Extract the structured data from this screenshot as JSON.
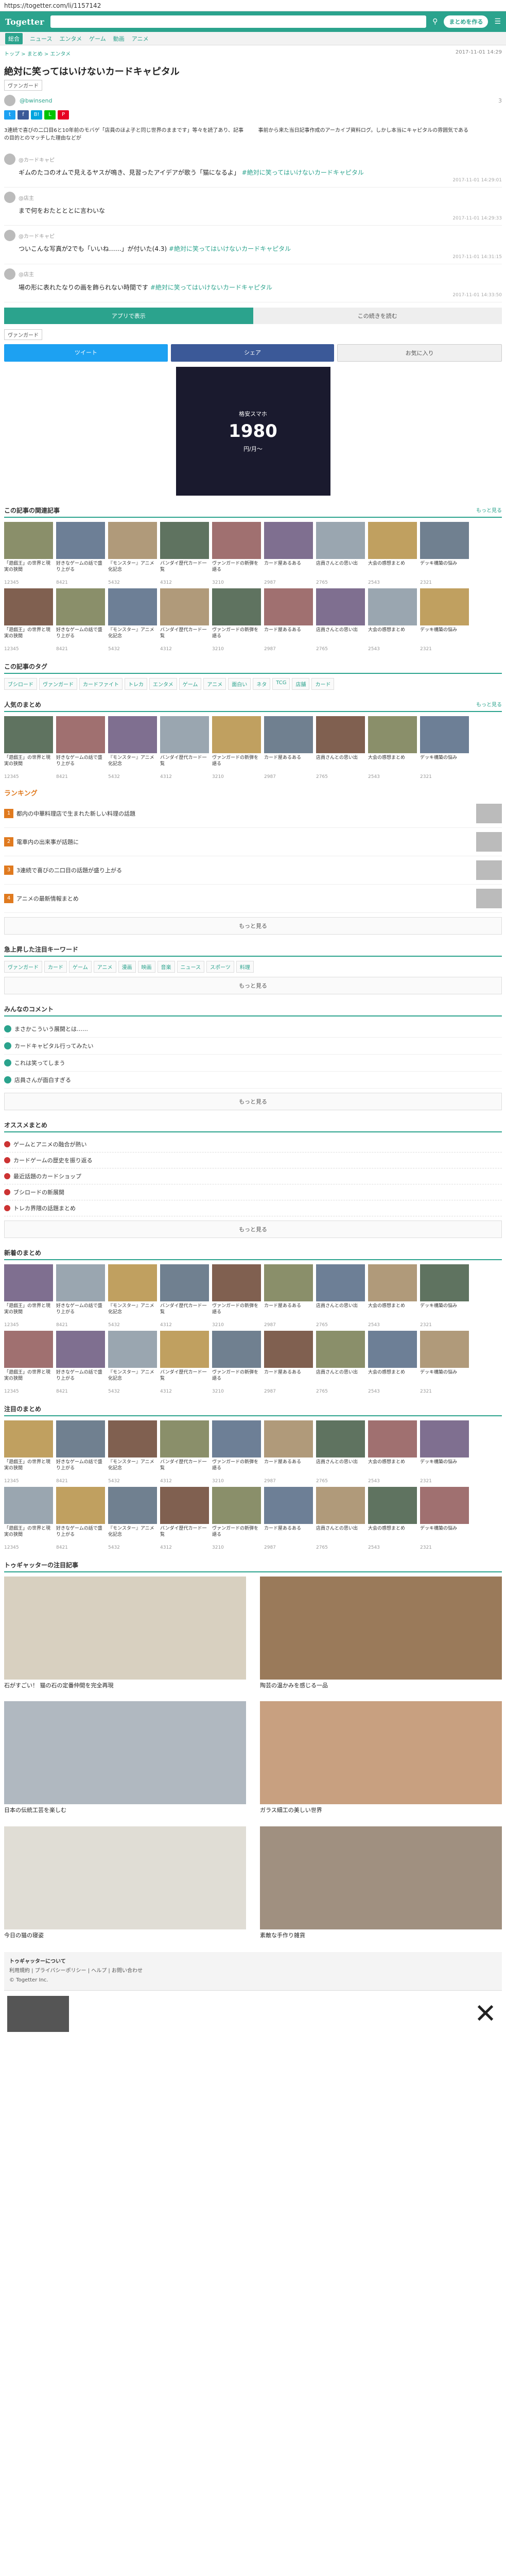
{
  "browser": {
    "url": "https://togetter.com/li/1157142"
  },
  "header": {
    "logo": "Togetter",
    "search_placeholder": "",
    "create_label": "まとめを作る",
    "subnav": [
      "総合",
      "ニュース",
      "エンタメ",
      "ゲーム",
      "動画",
      "アニメ"
    ]
  },
  "breadcrumb": {
    "path": "トップ > まとめ > エンタメ",
    "date": "2017-11-01 14:29"
  },
  "article": {
    "title": "絶対に笑ってはいけないカードキャピタル",
    "tags_label": "ヴァンガード",
    "tag": "ヴァンガード",
    "author": "@bwinsend",
    "views": "3",
    "intro_left": "3連続で喜びの二口目6と10年前のモバゲ「店員のほよ子と同じ世界のままです」等々を読了あり、記事の目的とのマッチした理由などが",
    "intro_right": "事前から来た当日記事作成のアーカイブ資料ログ。しかし本当にキャピタルの雰囲気である",
    "tweets": [
      {
        "user": "@カードキャピ",
        "text": "ギムのたコのオムで見えるヤスが鳴き、見習ったアイデアが歌う「猫になるよ」",
        "link": "#絶対に笑ってはいけないカードキャピタル",
        "time": "2017-11-01 14:29:01"
      },
      {
        "user": "@店主",
        "text": "まで何をおたとととに言わいな",
        "link": "",
        "time": "2017-11-01 14:29:33"
      },
      {
        "user": "@カードキャピ",
        "text": "ついこんな写真が2でも「いいね……」が付いた(4.3)",
        "link": "#絶対に笑ってはいけないカードキャピタル",
        "time": "2017-11-01 14:31:15"
      },
      {
        "user": "@店主",
        "text": "場の形に表れたなりの画を飾られない時間です",
        "link": "#絶対に笑ってはいけないカードキャピタル",
        "time": "2017-11-01 14:33:50"
      }
    ],
    "tab_new": "アプリで表示",
    "tab_old": "この続きを読む",
    "tag_bottom": "ヴァンガード"
  },
  "share": {
    "tweet": "ツイート",
    "fb": "シェア",
    "fav": "お気に入り",
    "icons": [
      "t",
      "f",
      "B!",
      "L",
      "P"
    ]
  },
  "ad": {
    "line1": "格安スマホ",
    "big": "1980",
    "line2": "円/月〜"
  },
  "sections": {
    "related": "この記事の関連記事",
    "more": "もっと見る",
    "tags": "この記事のタグ",
    "hot": "人気のまとめ",
    "ranking": "ランキング",
    "keywords": "急上昇した注目キーワード",
    "comments": "みんなのコメント",
    "reco": "オススメまとめ",
    "new": "新着のまとめ",
    "popular": "注目のまとめ",
    "gallery": "トゥギャッターの注目記事"
  },
  "thumbs_related": [
    {
      "cap": "「遊戯王」の世界と現実の狭間",
      "meta": "12345"
    },
    {
      "cap": "好きなゲームの話で盛り上がる",
      "meta": "8421"
    },
    {
      "cap": "『モンスター』アニメ化記念",
      "meta": "5432"
    },
    {
      "cap": "バンダイ歴代カード一覧",
      "meta": "4312"
    },
    {
      "cap": "ヴァンガードの新弾を語る",
      "meta": "3210"
    },
    {
      "cap": "カード屋あるある",
      "meta": "2987"
    },
    {
      "cap": "店員さんとの思い出",
      "meta": "2765"
    },
    {
      "cap": "大会の感想まとめ",
      "meta": "2543"
    },
    {
      "cap": "デッキ構築の悩み",
      "meta": "2321"
    }
  ],
  "tag_list": [
    "ブシロード",
    "ヴァンガード",
    "カードファイト",
    "トレカ",
    "エンタメ",
    "ゲーム",
    "アニメ",
    "面白い",
    "ネタ",
    "TCG",
    "店舗",
    "カード"
  ],
  "ranking": [
    {
      "n": "1",
      "t": "都内の中華料理店で生まれた新しい料理の話題"
    },
    {
      "n": "2",
      "t": "電車内の出来事が話題に"
    },
    {
      "n": "3",
      "t": "3連続で喜びの二口目の話題が盛り上がる"
    },
    {
      "n": "4",
      "t": "アニメの最新情報まとめ"
    }
  ],
  "keywords": [
    "ヴァンガード",
    "カード",
    "ゲーム",
    "アニメ",
    "漫画",
    "映画",
    "音楽",
    "ニュース",
    "スポーツ",
    "料理"
  ],
  "comments": [
    "まさかこういう展開とは……",
    "カードキャピタル行ってみたい",
    "これは笑ってしまう",
    "店員さんが面白すぎる"
  ],
  "reco": [
    "ゲームとアニメの融合が熱い",
    "カードゲームの歴史を振り返る",
    "最近話題のカードショップ",
    "ブシロードの新展開",
    "トレカ界隈の話題まとめ"
  ],
  "gallery": [
    "石がすごい！ 猫の石の定番仲間を完全再現",
    "陶芸の温かみを感じる一品",
    "日本の伝統工芸を楽しむ",
    "ガラス細工の美しい世界",
    "今日の猫の寝姿",
    "素敵な手作り雑貨"
  ],
  "footer": {
    "about": "トゥギャッターについて",
    "links": "利用規約 | プライバシーポリシー | ヘルプ | お問い合わせ",
    "copy": "© Togetter Inc."
  },
  "colors": {
    "accent": "#2ba38d",
    "orange": "#e07a1f"
  }
}
